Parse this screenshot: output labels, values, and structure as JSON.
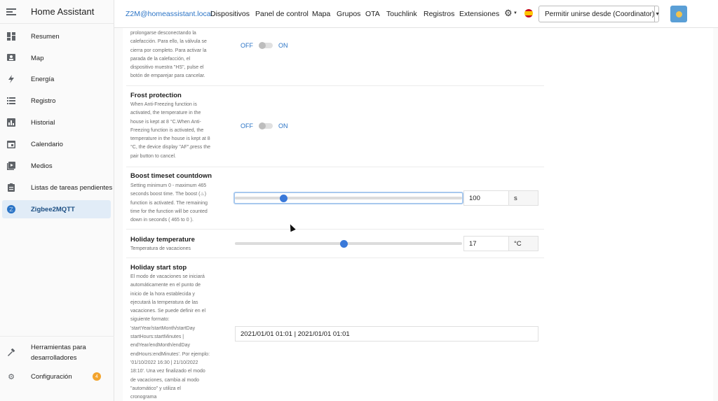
{
  "app": {
    "title": "Home Assistant"
  },
  "sidebar": {
    "items": [
      {
        "label": "Resumen"
      },
      {
        "label": "Map"
      },
      {
        "label": "Energía"
      },
      {
        "label": "Registro"
      },
      {
        "label": "Historial"
      },
      {
        "label": "Calendario"
      },
      {
        "label": "Medios"
      },
      {
        "label": "Listas de tareas pendientes"
      },
      {
        "label": "Zigbee2MQTT"
      }
    ],
    "bottom": {
      "tools_line1": "Herramientas para",
      "tools_line2": "desarrolladores",
      "settings": "Configuración",
      "settings_badge": "4"
    }
  },
  "topbar": {
    "brand": "Z2M@homeassistant.local",
    "links": [
      "Dispositivos",
      "Panel de control",
      "Mapa",
      "Grupos",
      "OTA",
      "Touchlink",
      "Registros",
      "Extensiones"
    ],
    "permit_join": "Permitir unirse desde (Coordinator)"
  },
  "settings": {
    "top_desc": [
      "prolongarse desconectando la",
      "calefacción. Para ello, la válvula se",
      "cierra por completo. Para activar la",
      "parada de la calefacción, el",
      "dispositivo muestra \"HS\", pulse el",
      "botón de emparejar para cancelar."
    ],
    "toggle_off": "OFF",
    "toggle_on": "ON",
    "frost": {
      "title": "Frost protection",
      "desc": [
        "When Anti-Freezing function is",
        "activated, the temperature in the",
        "house is kept at 8 °C.When Anti-",
        "Freezing function is activated, the",
        "temperature in the house is kept at 8",
        "°C, the device display \"AF\".press the",
        "pair button to cancel."
      ]
    },
    "boost": {
      "title": "Boost timeset countdown",
      "desc": [
        "Setting minimum 0 - maximum 465",
        "seconds boost time. The boost (♨)",
        "function is activated. The remaining",
        "time for the function will be counted",
        "down in seconds ( 465 to 0 )."
      ],
      "value": "100",
      "unit": "s",
      "min": 0,
      "max": 465
    },
    "holiday_temp": {
      "title": "Holiday temperature",
      "desc": "Temperatura de vacaciones",
      "value": "17",
      "unit": "°C",
      "level": 0.48
    },
    "holiday_start": {
      "title": "Holiday start stop",
      "desc": [
        "El modo de vacaciones se iniciará",
        "automáticamente en el punto de",
        "inicio de la hora establecida y",
        "ejecutará la temperatura de las",
        "vacaciones. Se puede definir en el",
        "siguiente formato:",
        "'startYear/startMonth/startDay",
        "startHours:startMinutes |",
        "endYear/endMonth/endDay",
        "endHours:endMinutes'. Por ejemplo:",
        "'01/10/2022 16:30 | 21/10/2022",
        "18:10'. Una vez finalizado el modo",
        "de vacaciones, cambia al modo",
        "\"automático\" y utiliza el",
        "cronograma"
      ],
      "value": "2021/01/01 01:01 | 2021/01/01 01:01"
    }
  }
}
